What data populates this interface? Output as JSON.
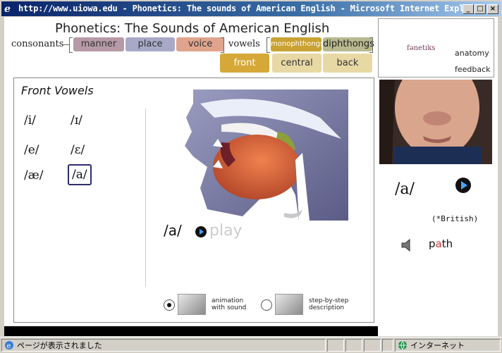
{
  "window": {
    "title": "http://www.uiowa.edu - Phonetics: The sounds of American English - Microsoft Internet Explorer"
  },
  "header": {
    "title": "Phonetics:  The Sounds of American English",
    "consonants_label": "consonants",
    "vowels_label": "vowels",
    "consonant_tabs": [
      "manner",
      "place",
      "voice"
    ],
    "vowel_tabs": [
      "monophthongs",
      "diphthongs"
    ],
    "sub_tabs": [
      "front",
      "central",
      "back"
    ]
  },
  "vowels": {
    "section_title": "Front Vowels",
    "symbols": [
      "/i/",
      "/ɪ/",
      "/e/",
      "/ɛ/",
      "/æ/",
      "/a/"
    ],
    "selected": "/a/"
  },
  "player": {
    "symbol": "/a/",
    "play_label": "play"
  },
  "options": {
    "animation": "animation\nwith sound",
    "stepbystep": "step-by-step\ndescription"
  },
  "right": {
    "logo": "fənetɪks",
    "anatomy": "anatomy",
    "feedback": "feedback",
    "symbol": "/a/",
    "note": "(*British)",
    "word_pre": "p",
    "word_hl": "a",
    "word_post": "th"
  },
  "status": {
    "text": "ページが表示されました",
    "zone": "インターネット"
  }
}
